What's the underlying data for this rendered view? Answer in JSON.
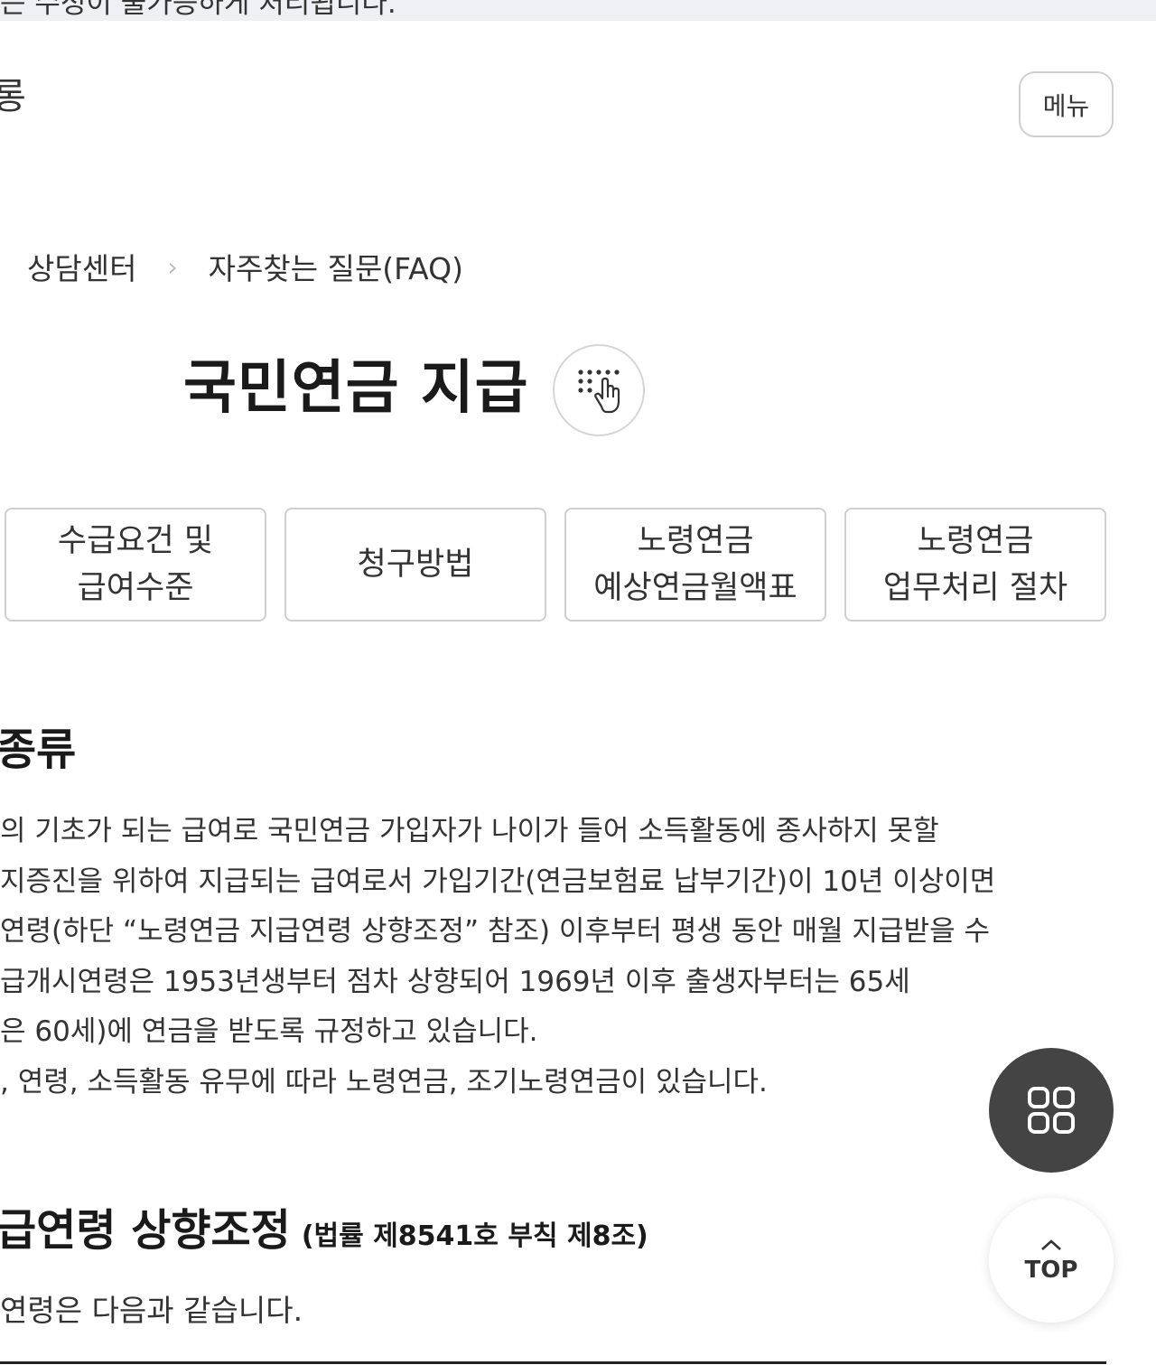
{
  "banner": {
    "text": "는 수정이 불가능하게 처리됩니다."
  },
  "header": {
    "logo_fragment": "롱",
    "menu_label": "메뉴"
  },
  "breadcrumb": {
    "items": [
      "상담센터",
      "자주찾는 질문(FAQ)"
    ]
  },
  "page": {
    "title": "국민연금 지급"
  },
  "tabs": [
    {
      "line1": "수급요건 및",
      "line2": "급여수준"
    },
    {
      "line1": "청구방법",
      "line2": ""
    },
    {
      "line1": "노령연금",
      "line2": "예상연금월액표"
    },
    {
      "line1": "노령연금",
      "line2": "업무처리 절차"
    }
  ],
  "section1": {
    "title": "종류",
    "lines": [
      "의 기초가 되는 급여로 국민연금 가입자가 나이가 들어 소득활동에 종사하지 못할",
      "지증진을 위하여 지급되는 급여로서 가입기간(연금보험료 납부기간)이 10년 이상이면",
      "연령(하단 “노령연금 지급연령 상향조정” 참조) 이후부터 평생 동안 매월 지급받을 수",
      "급개시연령은 1953년생부터 점차 상향되어 1969년 이후 출생자부터는 65세",
      "은 60세)에 연금을 받도록 규정하고 있습니다.",
      ", 연령, 소득활동 유무에 따라 노령연금, 조기노령연금이 있습니다."
    ]
  },
  "section2": {
    "title": "급연령 상향조정",
    "law_ref": "(법률 제8541호 부칙 제8조)",
    "intro": " 연령은 다음과 같습니다."
  },
  "floating": {
    "top_label": "TOP"
  }
}
